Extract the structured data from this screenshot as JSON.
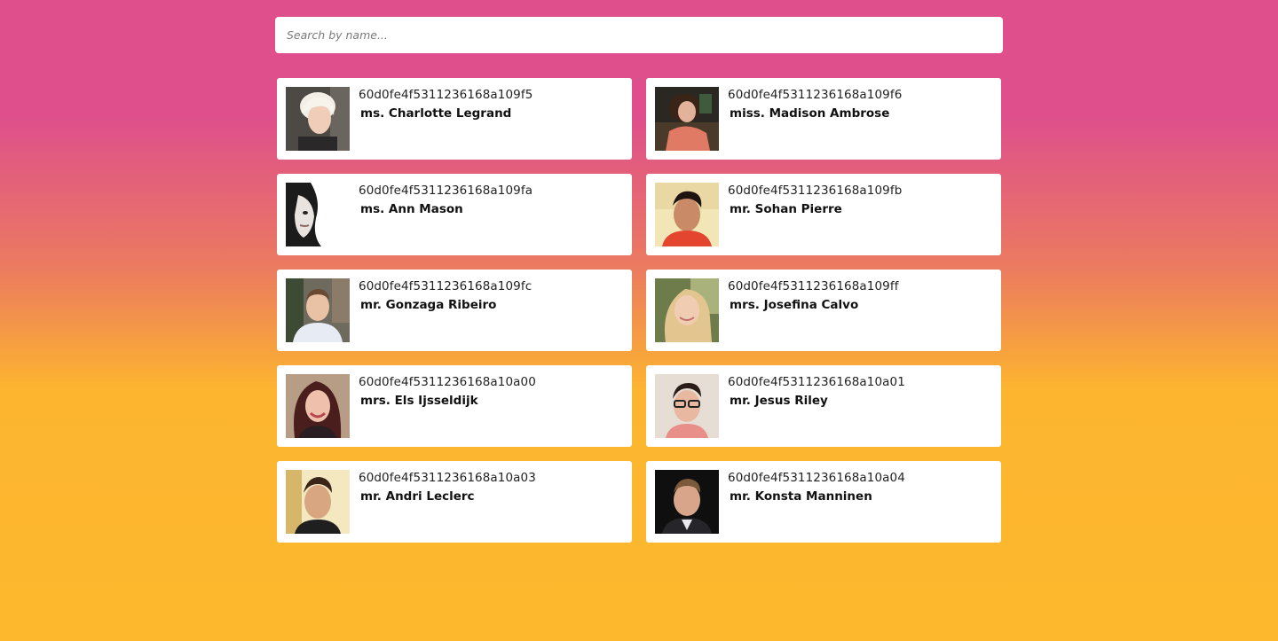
{
  "search": {
    "placeholder": "Search by name...",
    "value": ""
  },
  "users": [
    {
      "id": "60d0fe4f5311236168a109f5",
      "name": "ms. Charlotte Legrand"
    },
    {
      "id": "60d0fe4f5311236168a109f6",
      "name": "miss. Madison Ambrose"
    },
    {
      "id": "60d0fe4f5311236168a109fa",
      "name": "ms. Ann Mason"
    },
    {
      "id": "60d0fe4f5311236168a109fb",
      "name": "mr. Sohan Pierre"
    },
    {
      "id": "60d0fe4f5311236168a109fc",
      "name": "mr. Gonzaga Ribeiro"
    },
    {
      "id": "60d0fe4f5311236168a109ff",
      "name": "mrs. Josefina Calvo"
    },
    {
      "id": "60d0fe4f5311236168a10a00",
      "name": "mrs. Els Ijsseldijk"
    },
    {
      "id": "60d0fe4f5311236168a10a01",
      "name": "mr. Jesus Riley"
    },
    {
      "id": "60d0fe4f5311236168a10a03",
      "name": "mr. Andri Leclerc"
    },
    {
      "id": "60d0fe4f5311236168a10a04",
      "name": "mr. Konsta Manninen"
    }
  ]
}
